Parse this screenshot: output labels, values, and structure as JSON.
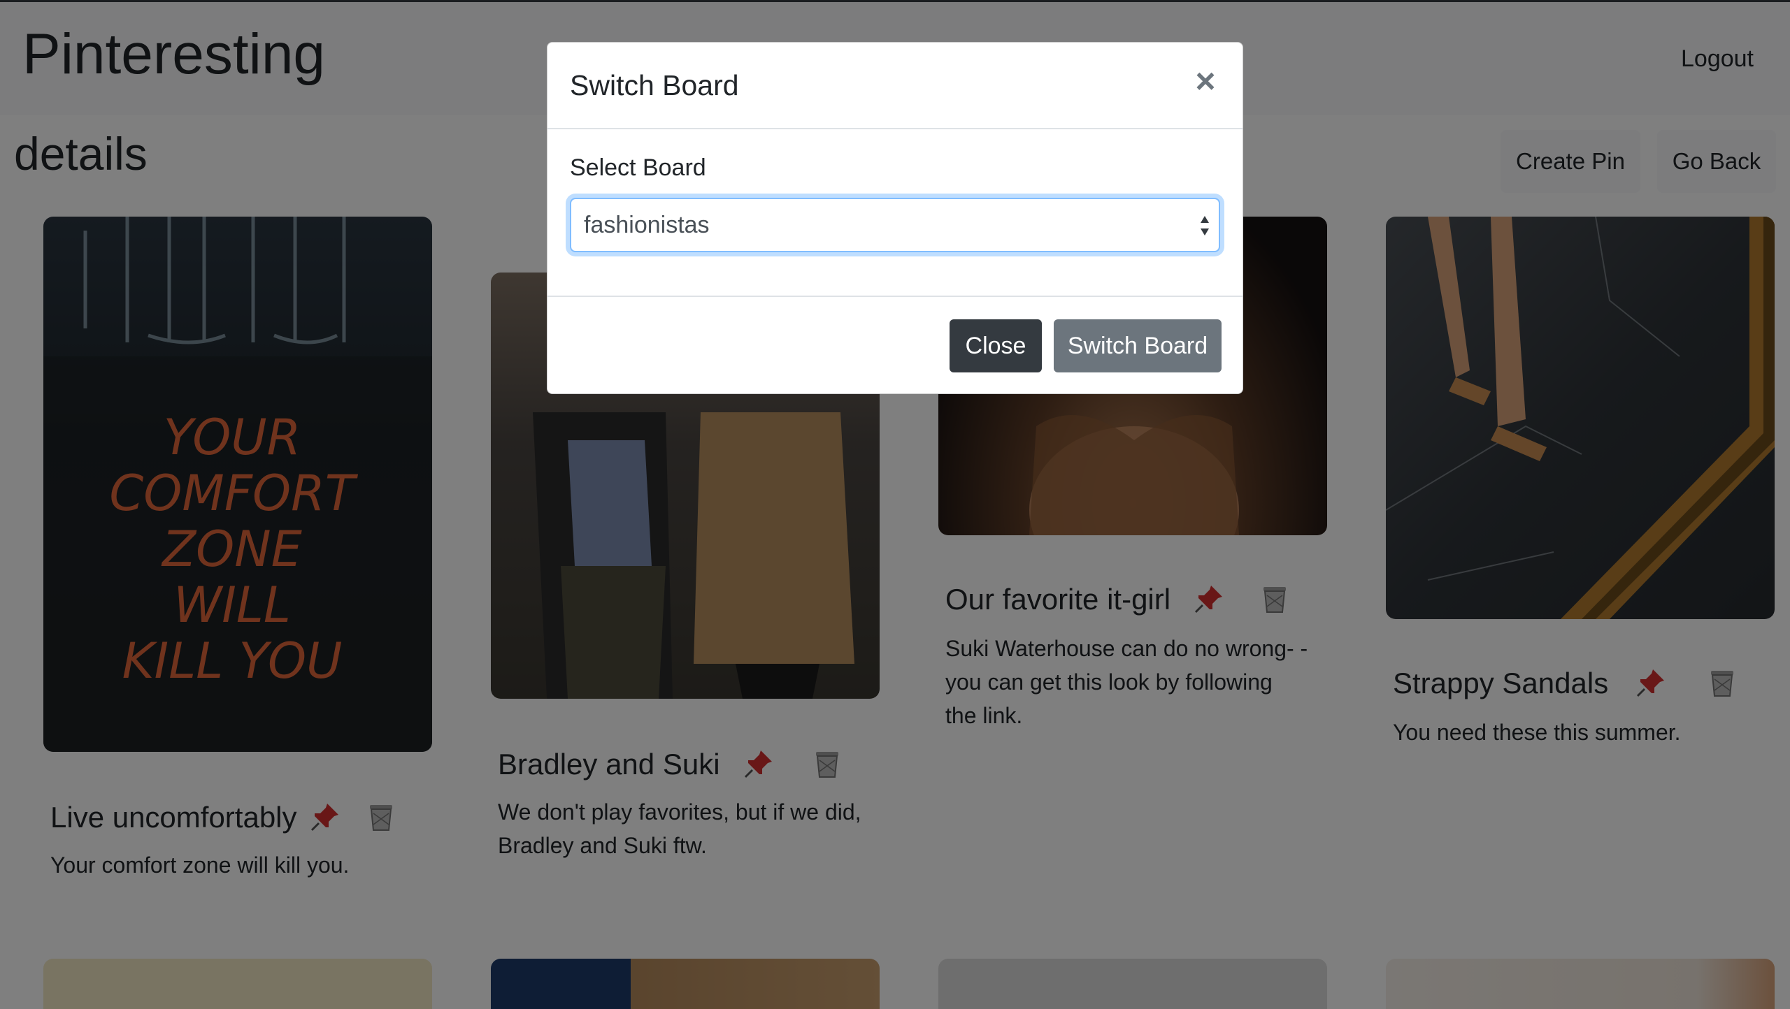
{
  "navbar": {
    "brand": "Pinteresting",
    "logout_label": "Logout"
  },
  "page": {
    "title": "details",
    "create_pin_label": "Create Pin",
    "go_back_label": "Go Back"
  },
  "pins": [
    {
      "title": "Live uncomfortably",
      "description": "Your comfort zone will kill you.",
      "image_text": "YOUR COMFORT ZONE WILL KILL YOU"
    },
    {
      "title": "Bradley and Suki",
      "description": "We don't play favorites, but if we did, Bradley and Suki ftw."
    },
    {
      "title": "Our favorite it-girl",
      "description": "Suki Waterhouse can do no wrong- - you can get this look by following the link."
    },
    {
      "title": "Strappy Sandals",
      "description": "You need these this summer."
    }
  ],
  "modal": {
    "title": "Switch Board",
    "close_symbol": "×",
    "select_label": "Select Board",
    "selected_board": "fashionistas",
    "close_button_label": "Close",
    "switch_button_label": "Switch Board"
  },
  "colors": {
    "overlay": "rgba(0,0,0,0.5)",
    "primary_dark": "#343a40",
    "secondary": "#6c757d",
    "focus_border": "#80bdff"
  },
  "icons": {
    "pin": "pushpin-icon",
    "delete": "trash-icon"
  }
}
